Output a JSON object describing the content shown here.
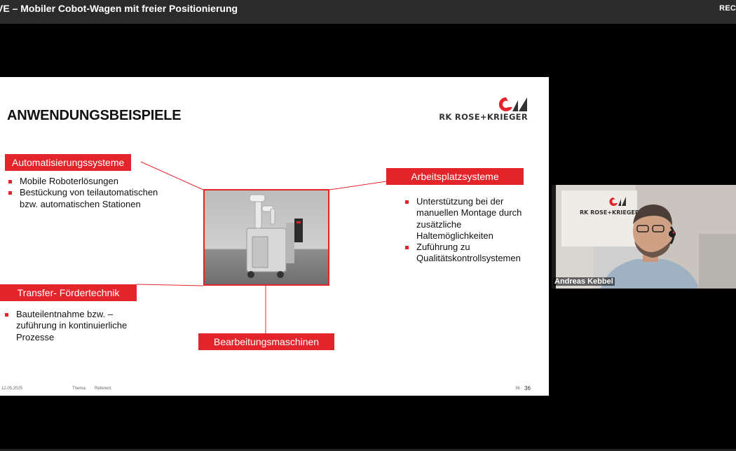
{
  "meeting": {
    "title": "VE – Mobiler Cobot-Wagen mit freier Positionierung",
    "rec_label": "REC"
  },
  "slide": {
    "title": "ANWENDUNGSBEISPIELE",
    "logo_text": "RK ROSE+KRIEGER",
    "labels": {
      "automation": "Automatisierungssysteme",
      "workplace": "Arbeitsplatzsysteme",
      "transfer": "Transfer- Fördertechnik",
      "machining": "Bearbeitungsmaschinen"
    },
    "automation_bullets": [
      "Mobile Roboterlösungen",
      "Bestückung von teilautomatischen bzw. automatischen  Stationen"
    ],
    "workplace_bullets": [
      "Unterstützung bei der manuellen Montage durch zusätzliche Haltemöglichkeiten",
      "Zuführung zu Qualitätskontrollsystemen"
    ],
    "transfer_bullets": [
      "Bauteilentnahme bzw. – zuführung in kontinuierliche Prozesse"
    ],
    "footer": {
      "date": "12.05.2025",
      "topic_label": "Thema:",
      "speaker_label": "Referent:",
      "page_small": "36",
      "page_large": "36"
    }
  },
  "webcam": {
    "speaker_name": "Andreas Kebbel",
    "background_logo_text": "RK ROSE+KRIEGER"
  },
  "colors": {
    "accent": "#e3242b",
    "topbar": "#2b2b2b"
  }
}
